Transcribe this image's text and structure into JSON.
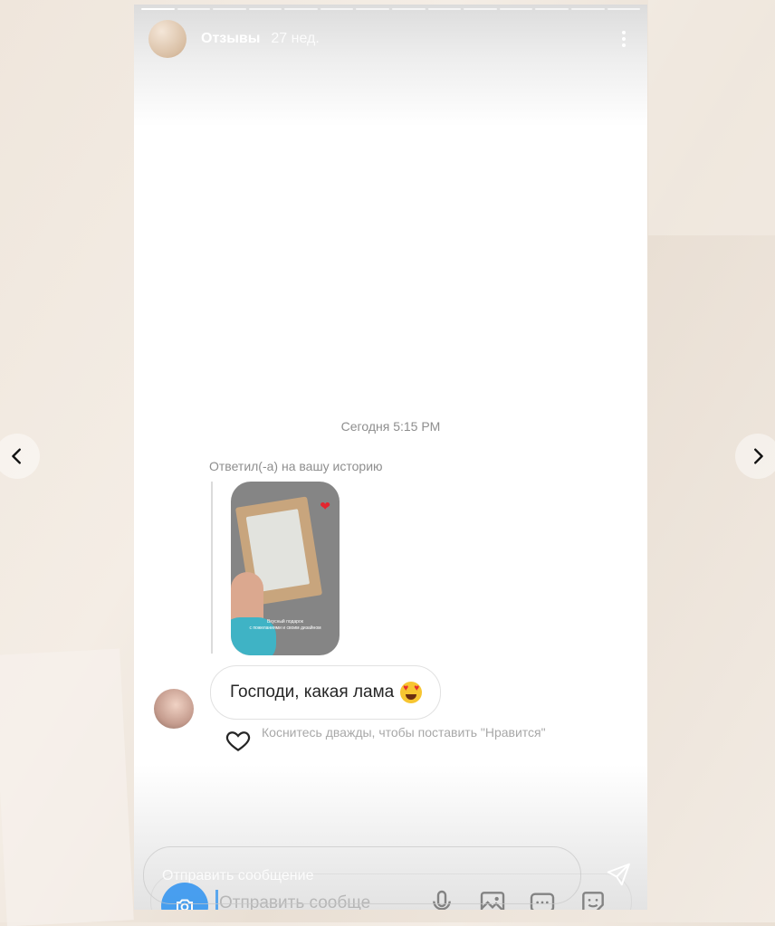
{
  "story": {
    "account_name": "Отзывы",
    "age": "27 нед.",
    "progress_segments": 14,
    "progress_done": 1
  },
  "conversation": {
    "timestamp": "Сегодня 5:15 PM",
    "reply_label": "Ответил(-а) на вашу историю",
    "story_thumbnail_caption": "Вкусный подарок\nс пожеланиями и своим дизайном",
    "message_text": "Господи, какая лама",
    "message_emoji": "heart-eyes-emoji",
    "like_hint": "Коснитесь дважды, чтобы поставить \"Нравится\""
  },
  "composer": {
    "story_reply_placeholder": "Отправить сообщение",
    "dm_placeholder": "Отправить сообще"
  },
  "icons": {
    "more": "more-vertical-icon",
    "heart": "heart-outline-icon",
    "send": "send-icon",
    "camera": "camera-icon",
    "mic": "microphone-icon",
    "gallery": "gallery-icon",
    "gif": "gif-icon",
    "sticker": "sticker-icon",
    "prev": "chevron-left-icon",
    "next": "chevron-right-icon"
  },
  "colors": {
    "accent": "#3797f0",
    "heart_red": "#e3262f",
    "muted_text": "#8e8e8e"
  }
}
